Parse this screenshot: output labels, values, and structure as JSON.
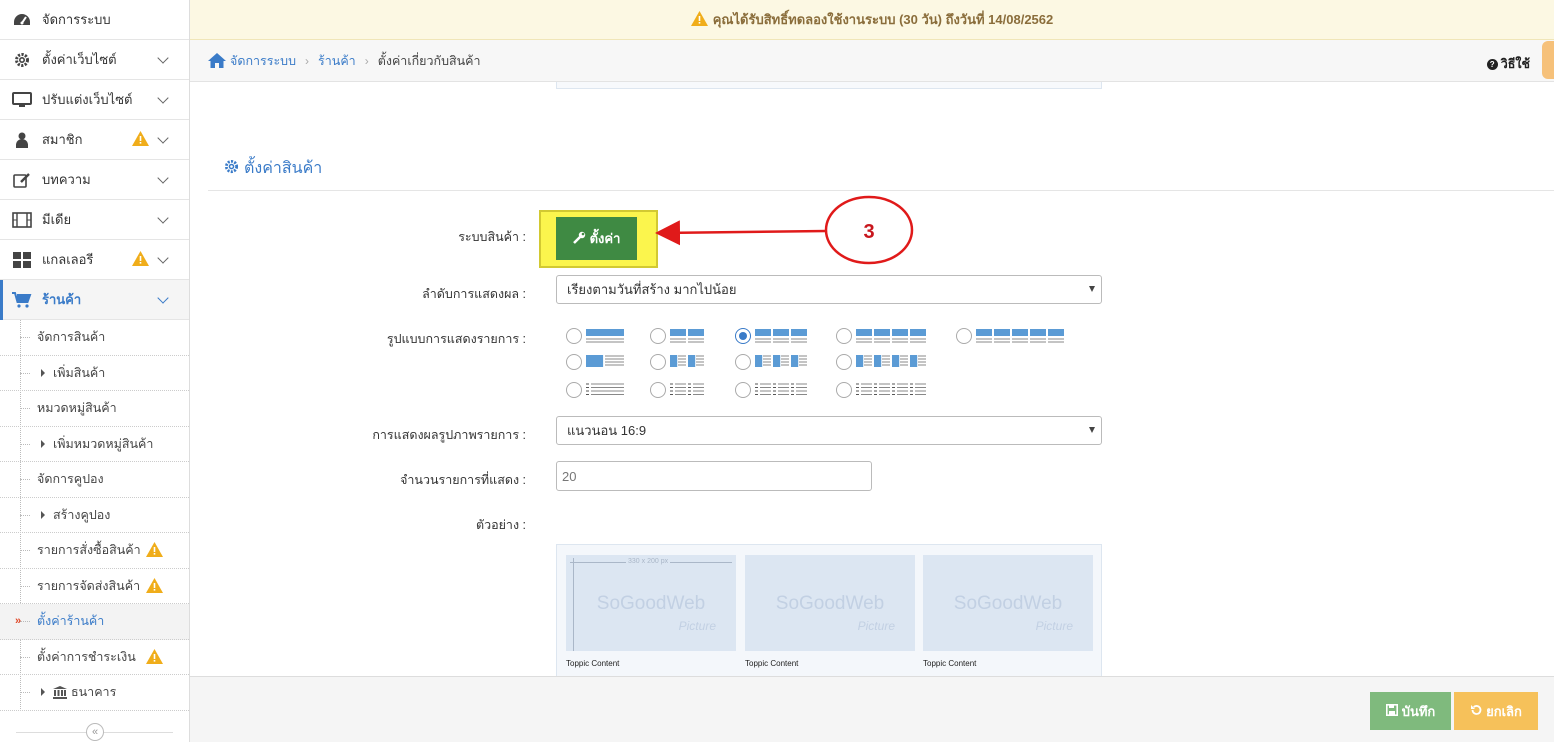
{
  "sidebar": {
    "items": [
      {
        "label": "จัดการระบบ",
        "icon": "dashboard-icon"
      },
      {
        "label": "ตั้งค่าเว็บไซต์",
        "icon": "gear-icon"
      },
      {
        "label": "ปรับแต่งเว็บไซต์",
        "icon": "monitor-icon"
      },
      {
        "label": "สมาชิก",
        "icon": "user-icon"
      },
      {
        "label": "บทความ",
        "icon": "edit-icon"
      },
      {
        "label": "มีเดีย",
        "icon": "film-icon"
      },
      {
        "label": "แกลเลอรี",
        "icon": "grid-icon"
      },
      {
        "label": "ร้านค้า",
        "icon": "cart-icon"
      }
    ],
    "shop_sub": [
      {
        "label": "จัดการสินค้า"
      },
      {
        "label": "เพิ่มสินค้า"
      },
      {
        "label": "หมวดหมู่สินค้า"
      },
      {
        "label": "เพิ่มหมวดหมู่สินค้า"
      },
      {
        "label": "จัดการคูปอง"
      },
      {
        "label": "สร้างคูปอง"
      },
      {
        "label": "รายการสั่งซื้อสินค้า"
      },
      {
        "label": "รายการจัดส่งสินค้า"
      },
      {
        "label": "ตั้งค่าร้านค้า"
      },
      {
        "label": "ตั้งค่าการชำระเงิน"
      },
      {
        "label": "ธนาคาร"
      }
    ],
    "collapse_glyph": "«",
    "current_marker": "»"
  },
  "notice": {
    "text": "คุณได้รับสิทธิ์ทดลองใช้งานระบบ (30 วัน) ถึงวันที่ 14/08/2562"
  },
  "breadcrumb": {
    "items": [
      "จัดการระบบ",
      "ร้านค้า",
      "ตั้งค่าเกี่ยวกับสินค้า"
    ],
    "sep": "›",
    "help": "วิธีใช้",
    "help_glyph": "?"
  },
  "section": {
    "title": "ตั้งค่าสินค้า"
  },
  "form": {
    "product_system_label": "ระบบสินค้า :",
    "settings_button": "ตั้งค่า",
    "display_order_label": "ลำดับการแสดงผล :",
    "display_order_value": "เรียงตามวันที่สร้าง มากไปน้อย",
    "layout_label": "รูปแบบการแสดงรายการ :",
    "image_display_label": "การแสดงผลรูปภาพรายการ :",
    "image_display_value": "แนวนอน 16:9",
    "count_label": "จำนวนรายการที่แสดง :",
    "count_value": "20",
    "example_label": "ตัวอย่าง :"
  },
  "preview": {
    "dimension": "330 x 200 px",
    "logo": "SoGoodWeb",
    "logo_sub": "Picture",
    "caption": "Toppic Content"
  },
  "annotation": {
    "number": "3"
  },
  "footer": {
    "save": "บันทึก",
    "cancel": "ยกเลิก"
  },
  "colors": {
    "accent": "#3a7bc8",
    "warning": "#f0ad1a",
    "settings_button": "#3f8a43",
    "highlight": "#fbf54d",
    "save_button": "#7fba7d",
    "cancel_button": "#f6c15a",
    "annotation": "#e01a1a"
  }
}
